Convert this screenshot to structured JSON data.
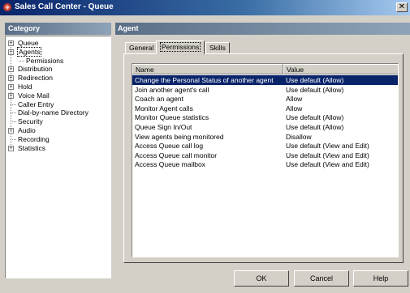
{
  "window": {
    "title": "Sales Call Center - Queue",
    "close_label": "✕"
  },
  "category": {
    "header": "Category",
    "tree": [
      {
        "label": "Queue",
        "expander": "+",
        "level": 0
      },
      {
        "label": "Agents",
        "expander": "−",
        "level": 0,
        "selected": true
      },
      {
        "label": "Permissions",
        "expander": "",
        "level": 1
      },
      {
        "label": "Distribution",
        "expander": "+",
        "level": 0
      },
      {
        "label": "Redirection",
        "expander": "+",
        "level": 0
      },
      {
        "label": "Hold",
        "expander": "+",
        "level": 0
      },
      {
        "label": "Voice Mail",
        "expander": "+",
        "level": 0
      },
      {
        "label": "Caller Entry",
        "expander": "",
        "level": 0
      },
      {
        "label": "Dial-by-name Directory",
        "expander": "",
        "level": 0
      },
      {
        "label": "Security",
        "expander": "",
        "level": 0
      },
      {
        "label": "Audio",
        "expander": "+",
        "level": 0
      },
      {
        "label": "Recording",
        "expander": "",
        "level": 0
      },
      {
        "label": "Statistics",
        "expander": "+",
        "level": 0
      }
    ]
  },
  "agent": {
    "header": "Agent",
    "tabs": [
      {
        "label": "General",
        "active": false
      },
      {
        "label": "Permissions",
        "active": true
      },
      {
        "label": "Skills",
        "active": false
      }
    ],
    "columns": [
      "Name",
      "Value"
    ],
    "rows": [
      {
        "name": "Change the Personal Status of another agent",
        "value": "Use default (Allow)",
        "selected": true
      },
      {
        "name": "Join another agent's call",
        "value": "Use default (Allow)"
      },
      {
        "name": "Coach an agent",
        "value": "Allow"
      },
      {
        "name": "Monitor Agent calls",
        "value": "Allow"
      },
      {
        "name": "Monitor Queue statistics",
        "value": "Use default (Allow)"
      },
      {
        "name": "Queue Sign In/Out",
        "value": "Use default (Allow)"
      },
      {
        "name": "View agents being monitored",
        "value": "Disallow"
      },
      {
        "name": "Access Queue call log",
        "value": "Use default (View and Edit)"
      },
      {
        "name": "Access Queue call monitor",
        "value": "Use default (View and Edit)"
      },
      {
        "name": "Access Queue mailbox",
        "value": "Use default (View and Edit)"
      }
    ]
  },
  "buttons": {
    "ok": "OK",
    "cancel": "Cancel",
    "help": "Help"
  }
}
